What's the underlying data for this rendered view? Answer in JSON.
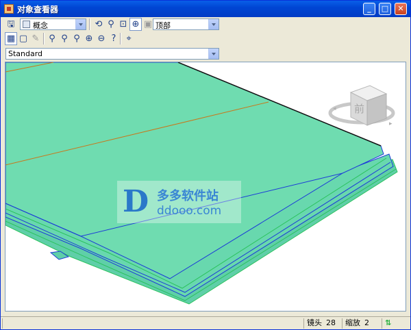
{
  "window": {
    "title": "对象查看器"
  },
  "titlebar_buttons": {
    "minimize": "_",
    "maximize": "□",
    "close": "✕"
  },
  "toolbar": {
    "visual_style": "概念",
    "view": "顶部",
    "named_view": "Standard"
  },
  "viewcube": {
    "face_label": "前"
  },
  "watermark": {
    "brand": "多多软件站",
    "url": "ddooo.com"
  },
  "status": {
    "lens_label": "镜头",
    "lens_value": "28",
    "zoom_label": "缩放",
    "zoom_value": "2"
  },
  "colors": {
    "model_fill": "#6fdcb0",
    "edge_blue": "#1b3ad8",
    "edge_orange": "#c9771a"
  }
}
